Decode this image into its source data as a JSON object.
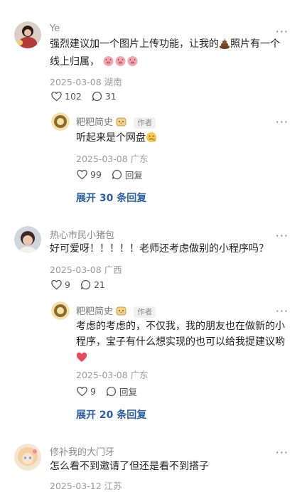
{
  "comments": [
    {
      "name": "Ye",
      "text_line1": "强烈建议加一个图片上传功能，让我的",
      "text_line1_tail": "照片有一个",
      "text_line2": "线上归属，",
      "date": "2025-03-08",
      "location": "湖南",
      "likes": "102",
      "replies": "31",
      "reply": {
        "name": "粑粑简史",
        "badge": "作者",
        "text": "听起来是个网盘",
        "date": "2025-03-08",
        "location": "广东",
        "likes": "99",
        "reply_label": "回复"
      },
      "expand_label": "展开 30 条回复"
    },
    {
      "name": "热心市民小猪包",
      "text": "好可爱呀！！！！！老师还考虑做别的小程序吗？",
      "date": "2025-03-08",
      "location": "广西",
      "likes": "9",
      "replies": "21",
      "reply": {
        "name": "粑粑简史",
        "badge": "作者",
        "text_line1": "考虑的考虑的，不仅我，我的朋友也在做新的小",
        "text_line2": "程序，宝子有什么想实现的也可以给我提建议哟",
        "date": "2025-03-08",
        "location": "广东",
        "likes": "9",
        "reply_label": "回复"
      },
      "expand_label": "展开 20 条回复"
    },
    {
      "name": "修补我的大门牙",
      "text": "怎么看不到邀请了但还是看不到搭子",
      "date": "2025-03-12",
      "location": "江苏"
    }
  ],
  "icons": {
    "more": "more-dots-icon",
    "like": "heart-outline-icon",
    "comment": "comment-bubble-icon"
  },
  "colors": {
    "link": "#2d5f9e",
    "meta": "#9a9a9a"
  }
}
